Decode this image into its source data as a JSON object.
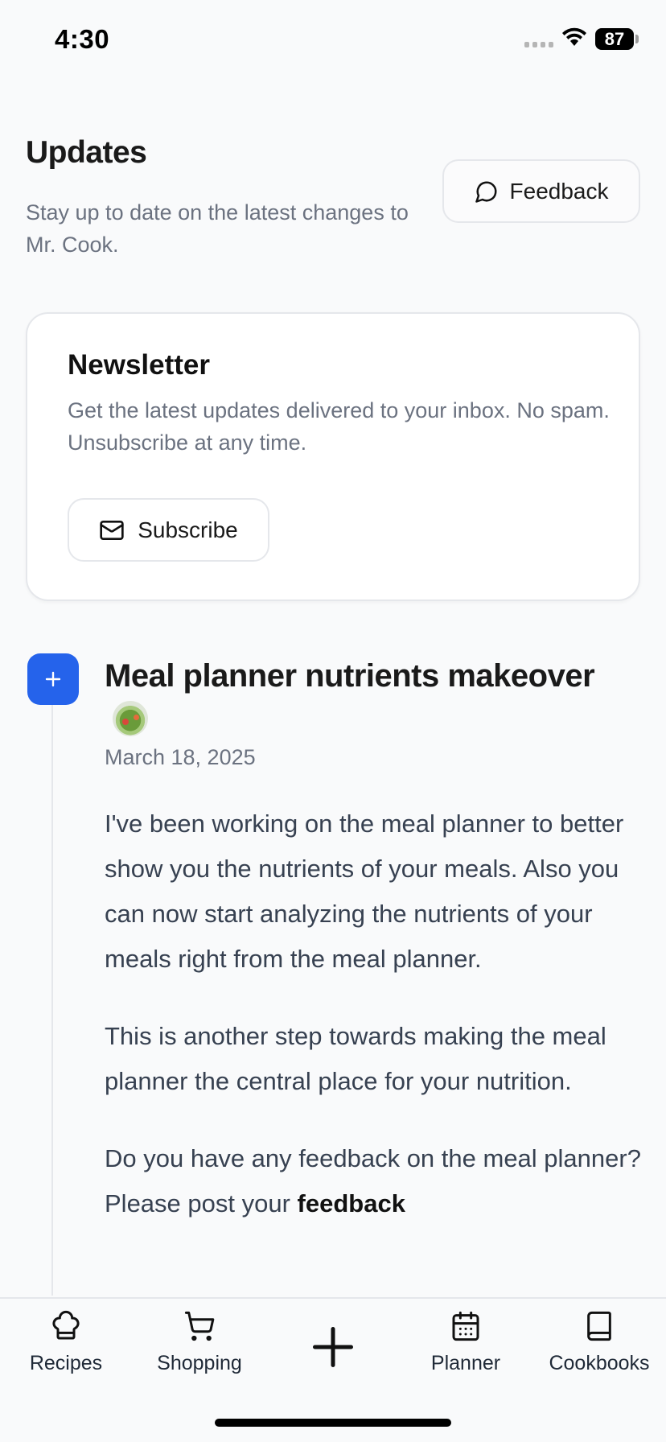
{
  "status_bar": {
    "time": "4:30",
    "battery": "87"
  },
  "header": {
    "title": "Updates",
    "subtitle": "Stay up to date on the latest changes to Mr. Cook.",
    "feedback_label": "Feedback"
  },
  "newsletter": {
    "title": "Newsletter",
    "text": "Get the latest updates delivered to your inbox. No spam. Unsubscribe at any time.",
    "subscribe_label": "Subscribe"
  },
  "entry": {
    "title": "Meal planner nutrients makeover",
    "date": "March 18, 2025",
    "paragraph_1": "I've been working on the meal planner to better show you the nutrients of your meals. Also you can now start analyzing the nutrients of your meals right from the meal planner.",
    "paragraph_2": "This is another step towards making the meal planner the central place for your nutrition.",
    "paragraph_3_prefix": "Do you have any feedback on the meal planner? Please post your ",
    "paragraph_3_link": "feedback"
  },
  "nav": {
    "items": [
      {
        "label": "Recipes",
        "icon": "chef-hat-icon"
      },
      {
        "label": "Shopping",
        "icon": "cart-icon"
      },
      {
        "label": "",
        "icon": "plus-icon"
      },
      {
        "label": "Planner",
        "icon": "calendar-icon"
      },
      {
        "label": "Cookbooks",
        "icon": "book-icon"
      }
    ]
  },
  "colors": {
    "accent": "#2563eb",
    "background": "#f9fafb",
    "muted_text": "#6b7280"
  }
}
